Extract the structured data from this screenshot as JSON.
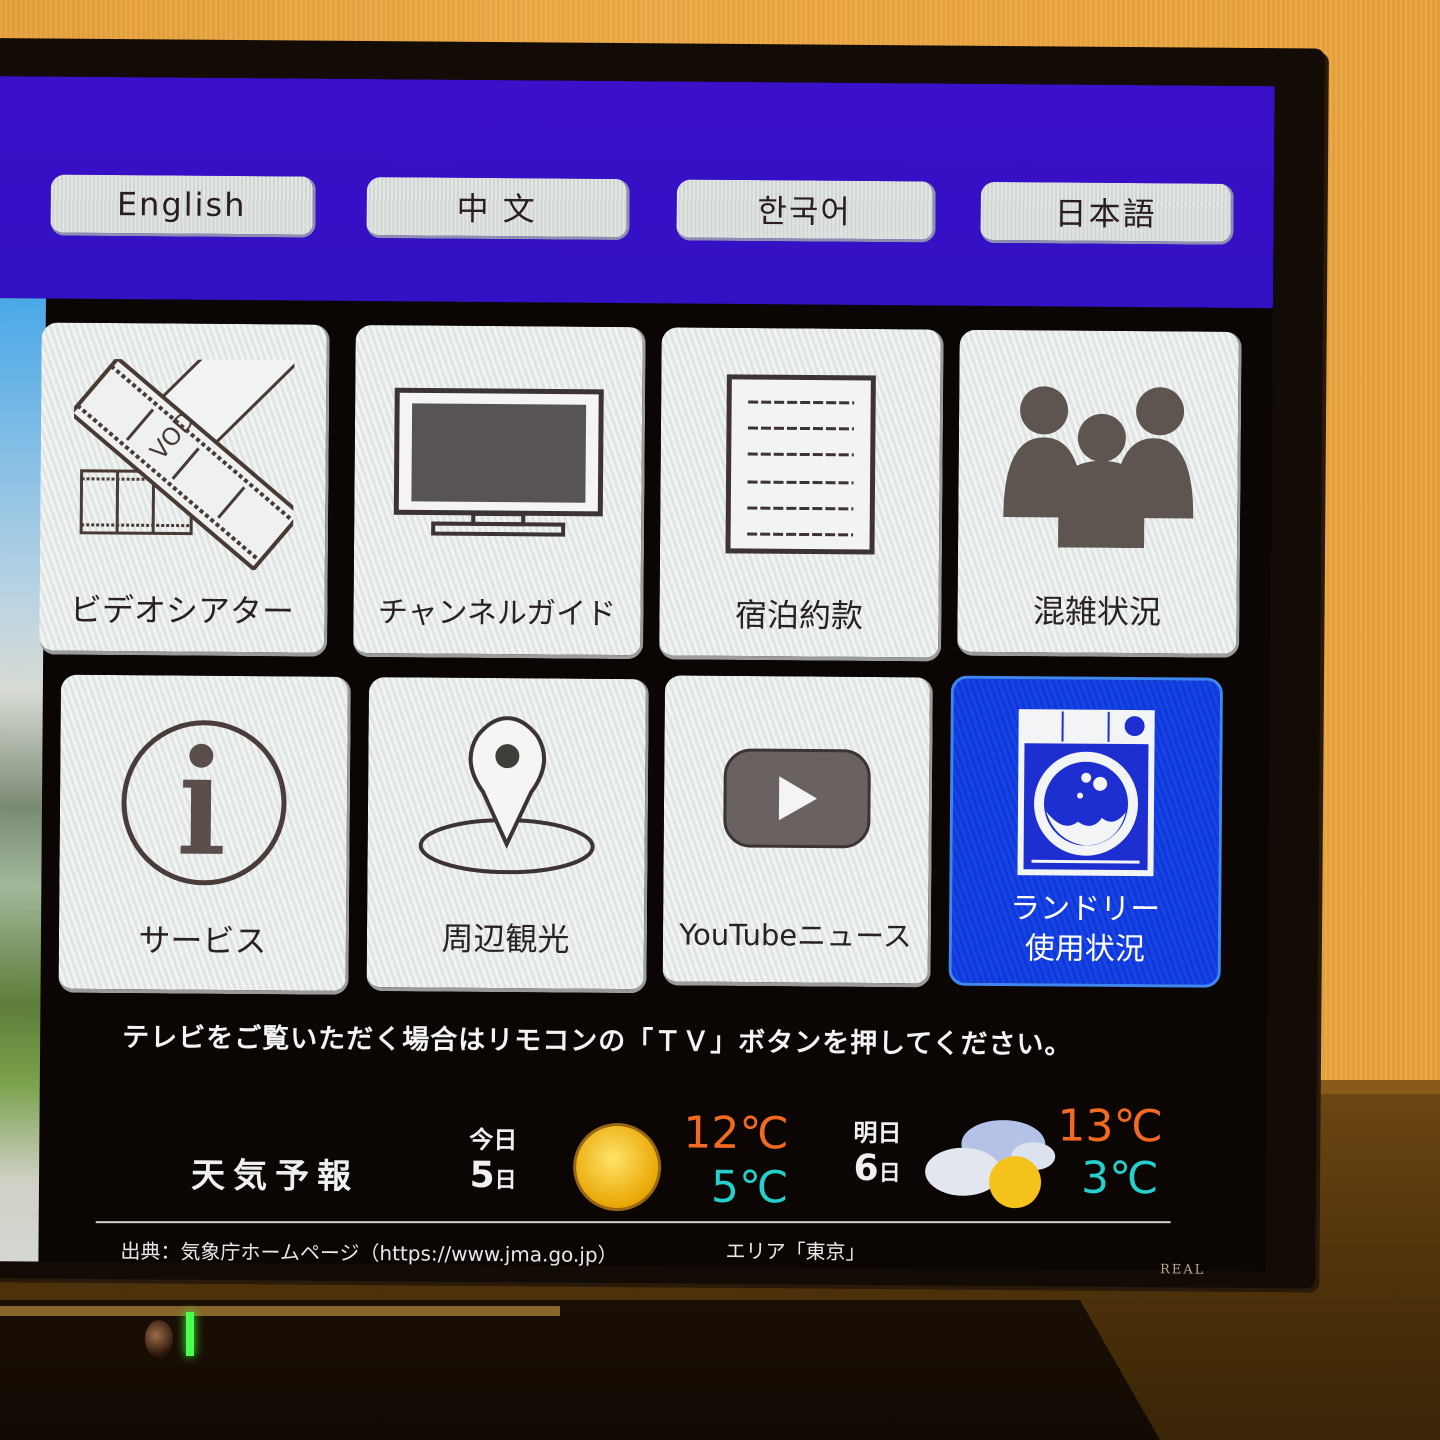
{
  "languages": [
    {
      "label": "English"
    },
    {
      "label": "中 文"
    },
    {
      "label": "한국어"
    },
    {
      "label": "日本語"
    }
  ],
  "menu": {
    "tiles": [
      {
        "label": "ビデオシアター",
        "icon": "vod-film-icon",
        "icon_text": "VOD"
      },
      {
        "label": "チャンネルガイド",
        "icon": "tv-icon"
      },
      {
        "label": "宿泊約款",
        "icon": "document-icon"
      },
      {
        "label": "混雑状況",
        "icon": "people-icon"
      },
      {
        "label": "サービス",
        "icon": "info-icon"
      },
      {
        "label": "周辺観光",
        "icon": "map-pin-icon"
      },
      {
        "label": "YouTubeニュース",
        "icon": "youtube-play-icon"
      },
      {
        "label_line1": "ランドリー",
        "label_line2": "使用状況",
        "icon": "washing-machine-icon",
        "selected": true
      }
    ],
    "selected_color": "#1240e0"
  },
  "notice": "テレビをご覧いただく場合はリモコンの「ＴＶ」ボタンを押してください。",
  "weather": {
    "title": "天気予報",
    "today": {
      "label": "今日",
      "day": "5",
      "day_suffix": "日",
      "condition": "sunny-icon",
      "high": "12℃",
      "low": "5℃"
    },
    "tomorrow": {
      "label": "明日",
      "day": "6",
      "day_suffix": "日",
      "condition": "cloudy-sunny-icon",
      "high": "13℃",
      "low": "3℃"
    },
    "source": "出典：気象庁ホームページ（https://www.jma.go.jp）",
    "area": "エリア「東京」",
    "high_color": "#f26a22",
    "low_color": "#25d0cc"
  },
  "tv_brand": "REAL",
  "header_color": "#3a10c8"
}
